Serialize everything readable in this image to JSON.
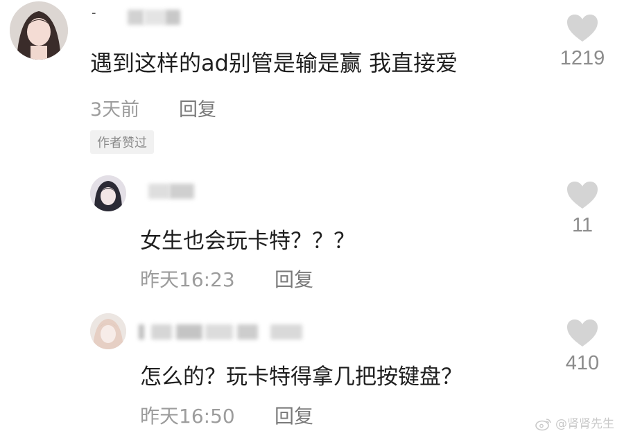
{
  "comments": [
    {
      "text": "遇到这样的ad别管是输是赢 我直接爱",
      "time": "3天前",
      "reply_label": "回复",
      "likes": "1219",
      "author_tag": "作者赞过",
      "username_prefix": "-"
    },
    {
      "text": "女生也会玩卡特？？？",
      "time": "昨天16:23",
      "reply_label": "回复",
      "likes": "11"
    },
    {
      "text": "怎么的？玩卡特得拿几把按键盘？",
      "time": "昨天16:50",
      "reply_label": "回复",
      "likes": "410"
    }
  ],
  "watermark": "@肾肾先生",
  "icons": {
    "like": "heart-icon",
    "watermark": "weibo-logo-icon"
  },
  "colors": {
    "heart": "#d4d4d4",
    "meta_text": "#9c9c9c",
    "body_text": "#1f1f1f"
  }
}
